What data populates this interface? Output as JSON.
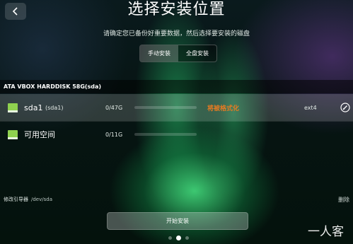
{
  "header": {
    "title": "选择安装位置",
    "subtitle": "请确定您已备份好重要数据，然后选择要安装的磁盘"
  },
  "mode_tabs": {
    "manual": "手动安装",
    "full_disk": "全盘安装",
    "selected": "manual"
  },
  "disk": {
    "name": "ATA VBOX HARDDISK 58G(sda)"
  },
  "partitions": [
    {
      "name": "sda1",
      "label": "(sda1)",
      "size": "0/47G",
      "usage_fraction": 0,
      "format_note": "将被格式化",
      "filesystem": "ext4",
      "icon": "partition-icon",
      "selected": true
    },
    {
      "name": "可用空间",
      "label": "",
      "size": "0/11G",
      "usage_fraction": 0,
      "format_note": "",
      "filesystem": "",
      "icon": "partition-icon",
      "selected": false
    }
  ],
  "bootloader": {
    "label": "修改引导器",
    "device": "/dev/sda"
  },
  "delete_label": "删除",
  "start_button": "开始安装",
  "pagination": {
    "count": 3,
    "active": 1
  },
  "watermark": "一人客",
  "colors": {
    "format_warning": "#e57a22",
    "partition_icon": "#8fd14f"
  }
}
